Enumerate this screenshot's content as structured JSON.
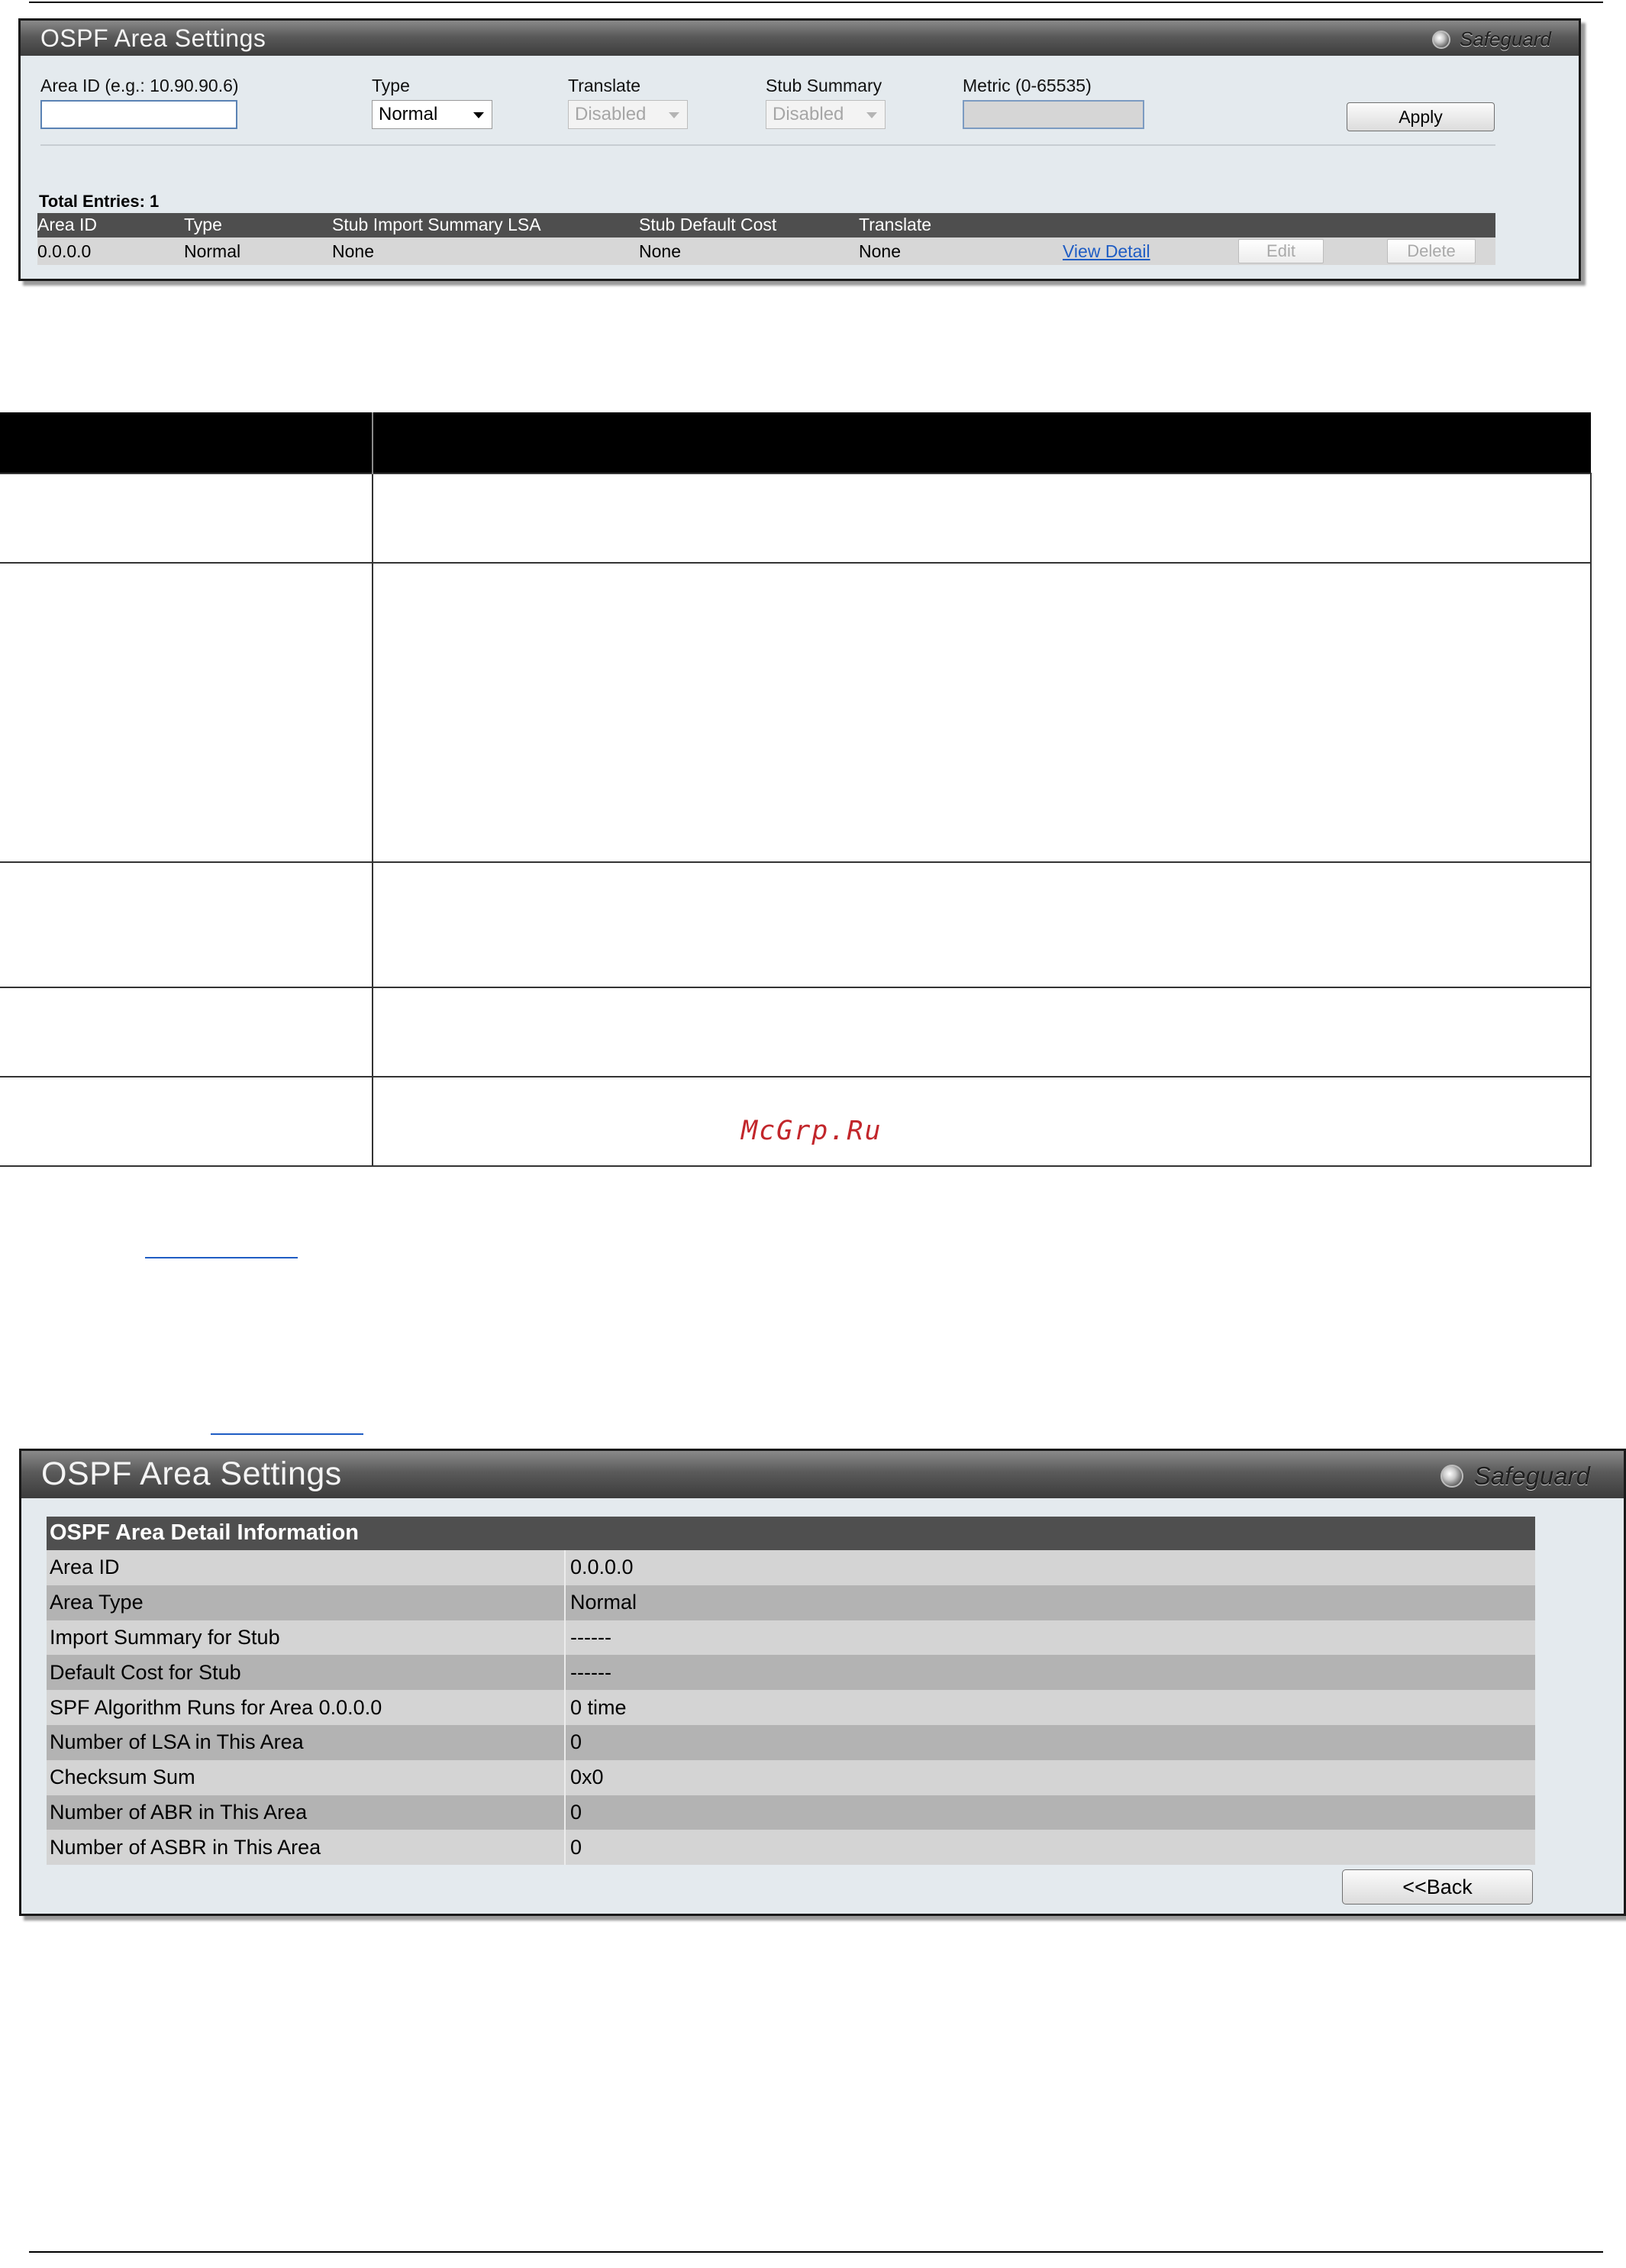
{
  "form_panel": {
    "title": "OSPF Area Settings",
    "safeguard": "Safeguard",
    "fields": {
      "area_id_label": "Area ID (e.g.: 10.90.90.6)",
      "area_id_value": "",
      "type_label": "Type",
      "type_value": "Normal",
      "translate_label": "Translate",
      "translate_value": "Disabled",
      "stub_summary_label": "Stub Summary",
      "stub_summary_value": "Disabled",
      "metric_label": "Metric (0-65535)",
      "metric_value": ""
    },
    "apply_label": "Apply",
    "total_entries": "Total Entries: 1",
    "columns": [
      "Area ID",
      "Type",
      "Stub Import Summary LSA",
      "Stub Default Cost",
      "Translate"
    ],
    "rows": [
      {
        "area_id": "0.0.0.0",
        "type": "Normal",
        "stub_import_summary_lsa": "None",
        "stub_default_cost": "None",
        "translate": "None",
        "view_detail": "View Detail",
        "edit": "Edit",
        "delete": "Delete"
      }
    ]
  },
  "watermark": "McGrp.Ru",
  "detail_panel": {
    "title": "OSPF Area Settings",
    "safeguard": "Safeguard",
    "header": "OSPF Area Detail Information",
    "rows": [
      {
        "label": "Area ID",
        "value": "0.0.0.0"
      },
      {
        "label": "Area Type",
        "value": "Normal"
      },
      {
        "label": "Import Summary for Stub",
        "value": "------"
      },
      {
        "label": "Default Cost for Stub",
        "value": "------"
      },
      {
        "label": "SPF Algorithm Runs for Area 0.0.0.0",
        "value": "0 time"
      },
      {
        "label": "Number of LSA in This Area",
        "value": "0"
      },
      {
        "label": "Checksum Sum",
        "value": "0x0"
      },
      {
        "label": "Number of ABR in This Area",
        "value": "0"
      },
      {
        "label": "Number of ASBR in This Area",
        "value": "0"
      }
    ],
    "back_label": "<<Back"
  }
}
